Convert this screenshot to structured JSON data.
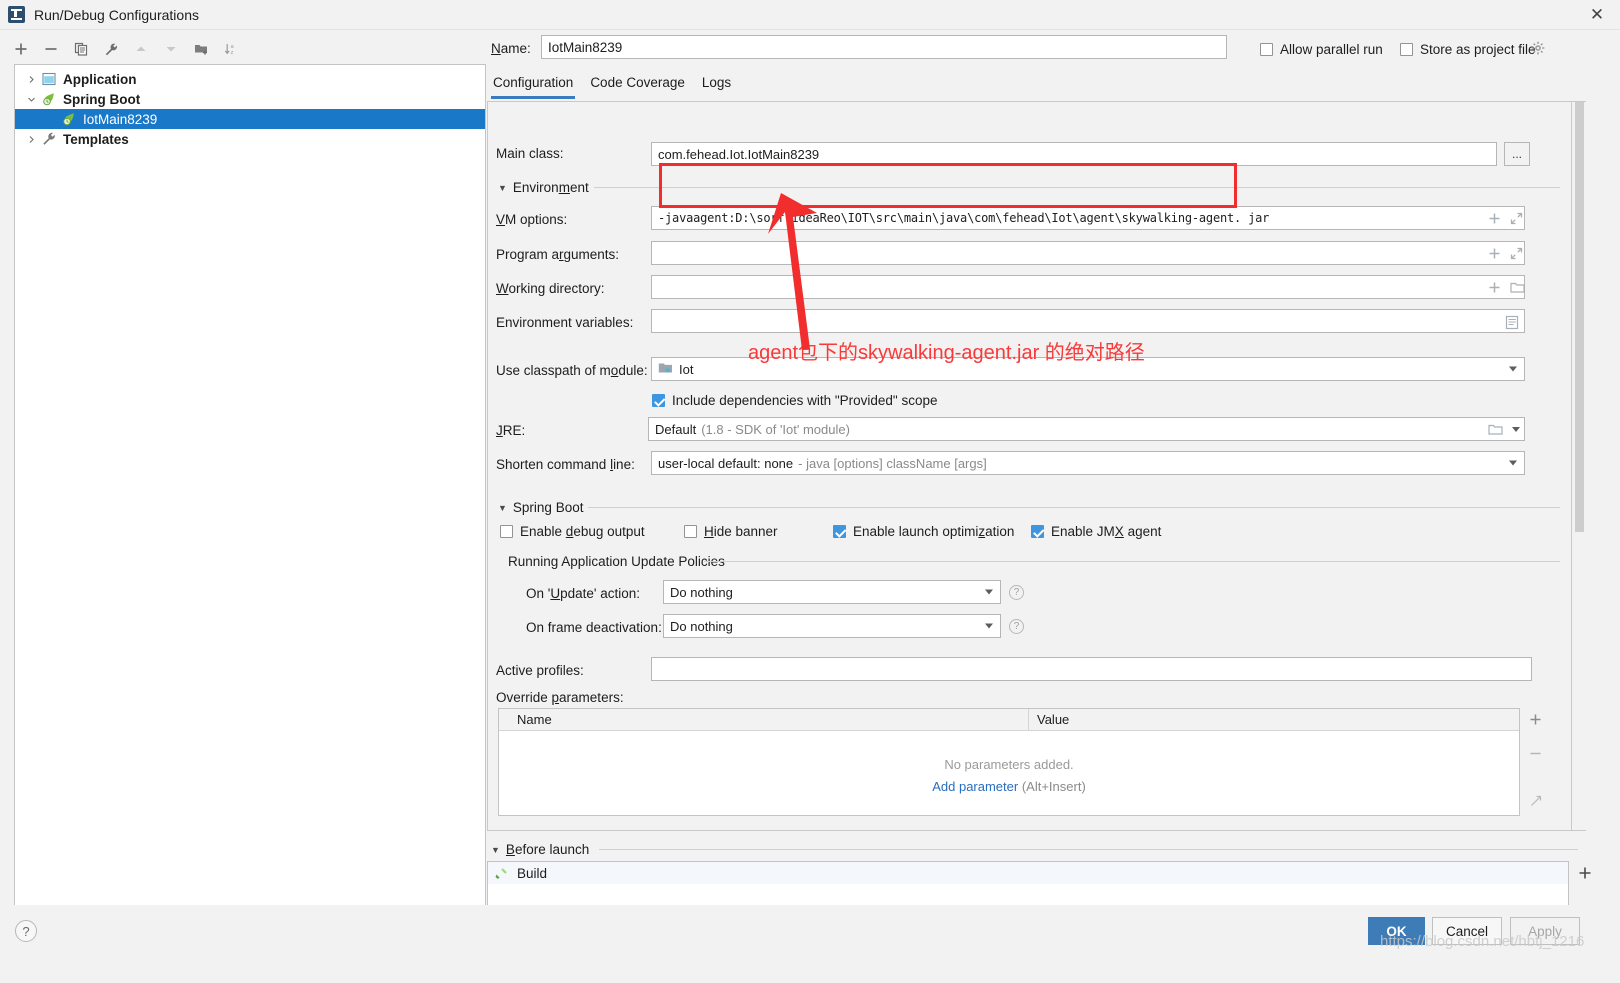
{
  "window": {
    "title": "Run/Debug Configurations",
    "app_icon": "intellij-idea-icon",
    "close_label": "✕"
  },
  "left_toolbar": {
    "buttons": [
      {
        "name": "add-configuration-button",
        "icon": "plus-icon"
      },
      {
        "name": "remove-configuration-button",
        "icon": "minus-icon"
      },
      {
        "name": "copy-configuration-button",
        "icon": "copy-icon"
      },
      {
        "name": "edit-templates-button",
        "icon": "wrench-icon"
      },
      {
        "name": "move-up-button",
        "icon": "arrow-up-icon"
      },
      {
        "name": "move-down-button",
        "icon": "arrow-down-icon"
      },
      {
        "name": "new-folder-button",
        "icon": "folder-add-icon"
      },
      {
        "name": "sort-configurations-button",
        "icon": "sort-az-icon"
      }
    ]
  },
  "tree": {
    "items": [
      {
        "label": "Application",
        "icon": "application-icon",
        "expander": "chevron-right-icon",
        "level": 0,
        "selected": false
      },
      {
        "label": "Spring Boot",
        "icon": "spring-boot-icon",
        "expander": "chevron-down-icon",
        "level": 0,
        "selected": false
      },
      {
        "label": "IotMain8239",
        "icon": "spring-boot-icon",
        "expander": "",
        "level": 1,
        "selected": true
      },
      {
        "label": "Templates",
        "icon": "wrench-icon",
        "expander": "chevron-right-icon",
        "level": 0,
        "selected": false
      }
    ]
  },
  "header": {
    "name_label": "Name:",
    "name_value": "IotMain8239",
    "allow_parallel_run": {
      "label": "Allow parallel run",
      "checked": false
    },
    "store_as_project_file": {
      "label": "Store as project file",
      "checked": false
    },
    "gear_icon": "gear-icon"
  },
  "tabs": [
    {
      "label": "Configuration",
      "active": true
    },
    {
      "label": "Code Coverage",
      "active": false
    },
    {
      "label": "Logs",
      "active": false
    }
  ],
  "configuration": {
    "main_class": {
      "label": "Main class:",
      "value": "com.fehead.Iot.IotMain8239",
      "browse_label": "..."
    },
    "environment_section": {
      "label": "Environment"
    },
    "vm_options": {
      "label": "VM options:",
      "value": "-javaagent:D:\\sorf\\ideaReo\\IOT\\src\\main\\java\\com\\fehead\\Iot\\agent\\skywalking-agent. jar",
      "placeholder": ""
    },
    "program_arguments": {
      "label": "Program arguments:",
      "value": ""
    },
    "working_directory": {
      "label": "Working directory:",
      "value": ""
    },
    "environment_variables": {
      "label": "Environment variables:",
      "value": ""
    },
    "use_classpath_of_module": {
      "label": "Use classpath of module:",
      "value": "Iot",
      "module_icon": "module-icon"
    },
    "include_provided": {
      "label": "Include dependencies with \"Provided\" scope",
      "checked": true
    },
    "jre": {
      "label": "JRE:",
      "value": "Default",
      "hint": "(1.8 - SDK of 'Iot' module)",
      "browse_icon": "folder-icon"
    },
    "shorten_command_line": {
      "label": "Shorten command line:",
      "value": "user-local default: none",
      "hint": "- java [options] className [args]"
    }
  },
  "spring_boot": {
    "section_label": "Spring Boot",
    "checkboxes": [
      {
        "label": "Enable debug output",
        "checked": false
      },
      {
        "label": "Hide banner",
        "checked": false
      },
      {
        "label": "Enable launch optimization",
        "checked": true
      },
      {
        "label": "Enable JMX agent",
        "checked": true
      }
    ],
    "update_policies": {
      "section_label": "Running Application Update Policies",
      "on_update_action": {
        "label": "On 'Update' action:",
        "value": "Do nothing",
        "help_icon": "question-icon"
      },
      "on_frame_deactivation": {
        "label": "On frame deactivation:",
        "value": "Do nothing",
        "help_icon": "question-icon"
      }
    },
    "active_profiles": {
      "label": "Active profiles:",
      "value": ""
    },
    "override_parameters": {
      "label": "Override parameters:",
      "columns": [
        "Name",
        "Value"
      ],
      "rows": [],
      "empty_text": "No parameters added.",
      "add_link": "Add parameter",
      "add_shortcut": "(Alt+Insert)",
      "side_buttons": [
        {
          "name": "add-parameter-button",
          "icon": "plus-icon"
        },
        {
          "name": "remove-parameter-button",
          "icon": "minus-icon"
        },
        {
          "name": "expand-parameters-button",
          "icon": "expand-icon"
        }
      ]
    }
  },
  "before_launch": {
    "section_label": "Before launch",
    "tasks": [
      {
        "label": "Build",
        "icon": "build-hammer-icon"
      }
    ],
    "side_buttons": [
      {
        "name": "add-task-button",
        "icon": "plus-icon"
      },
      {
        "name": "remove-task-button",
        "icon": "minus-icon"
      },
      {
        "name": "edit-task-button",
        "icon": "pencil-icon"
      }
    ]
  },
  "footer": {
    "help_label": "?",
    "ok_label": "OK",
    "cancel_label": "Cancel",
    "apply_label": "Apply"
  },
  "annotations": {
    "red_note": "agent包下的skywalking-agent.jar 的绝对路径",
    "highlight_color": "#f22d2d",
    "arrow_color": "#f22d2d",
    "watermark": "https://blog.csdn.net/hbtj_1216"
  }
}
